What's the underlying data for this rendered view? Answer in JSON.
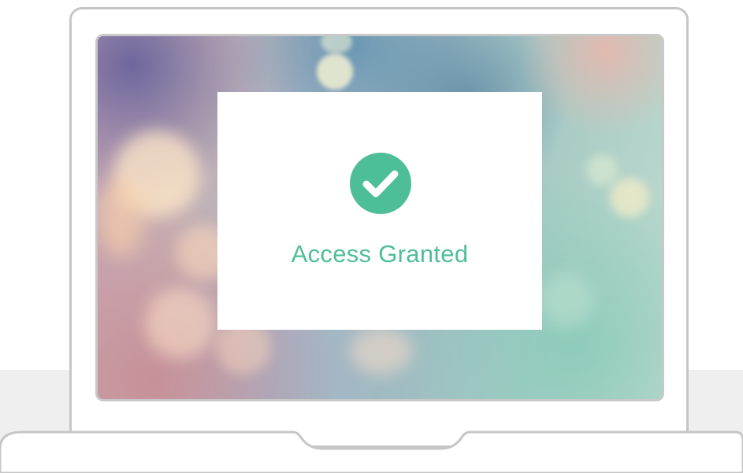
{
  "dialog": {
    "status_text": "Access Granted",
    "icon": "check-circle-icon",
    "accent_color": "#4dbe98"
  },
  "device": {
    "frame_color": "#c6c6c6"
  }
}
